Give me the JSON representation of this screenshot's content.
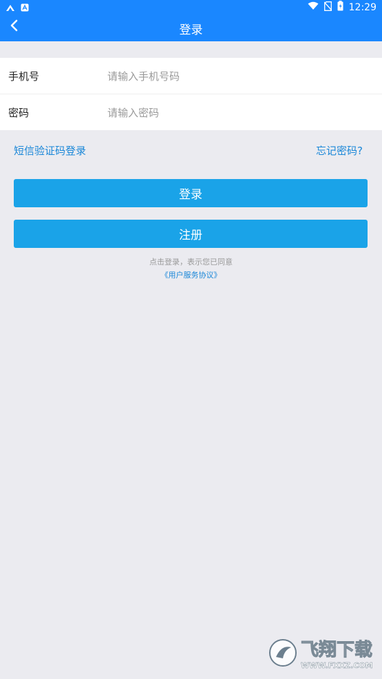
{
  "status_bar": {
    "time": "12:29",
    "left_icons": [
      "app-icon",
      "notification-icon"
    ],
    "right_icons": [
      "wifi-icon",
      "no-sim-icon",
      "battery-icon"
    ]
  },
  "app_bar": {
    "title": "登录",
    "back_icon": "back-chevron-icon"
  },
  "form": {
    "phone_label": "手机号",
    "phone_placeholder": "请输入手机号码",
    "password_label": "密码",
    "password_placeholder": "请输入密码"
  },
  "links": {
    "sms_login": "短信验证码登录",
    "forgot_password": "忘记密码?"
  },
  "buttons": {
    "login": "登录",
    "register": "注册"
  },
  "agreement": {
    "text": "点击登录，表示您已同意",
    "link": "《用户服务协议》"
  },
  "watermark": {
    "brand": "飞翔下载",
    "url": "WWW.FXXZ.COM"
  },
  "colors": {
    "primary": "#1a87ff",
    "button": "#1aa3e8",
    "link": "#1a87d8",
    "background": "#ebebf0"
  }
}
